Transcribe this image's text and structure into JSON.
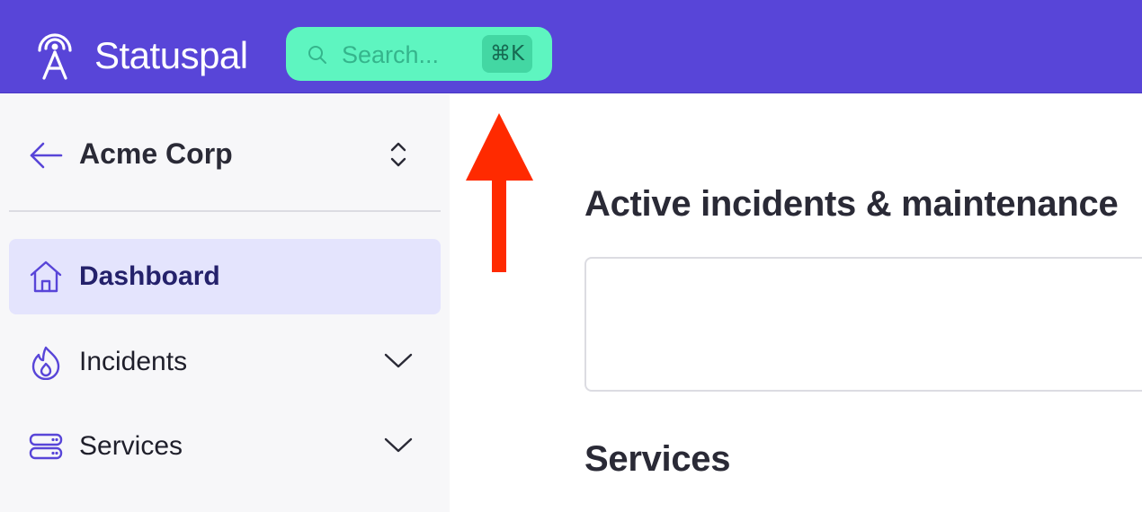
{
  "app": {
    "brand": "Statuspal",
    "logo_icon": "broadcast-tower-icon",
    "accent_color": "#5845d8"
  },
  "search": {
    "placeholder": "Search...",
    "shortcut": "⌘K",
    "icon": "search-icon",
    "background": "#5ef5c0"
  },
  "sidebar": {
    "org": {
      "back_icon": "arrow-left-icon",
      "name": "Acme Corp",
      "switch_icon": "chevron-up-down-icon"
    },
    "items": [
      {
        "label": "Dashboard",
        "icon": "home-icon",
        "active": true,
        "expandable": false
      },
      {
        "label": "Incidents",
        "icon": "fire-icon",
        "active": false,
        "expandable": true
      },
      {
        "label": "Services",
        "icon": "server-icon",
        "active": false,
        "expandable": true
      }
    ]
  },
  "main": {
    "active_heading": "Active incidents & maintenance",
    "services_heading": "Services"
  },
  "annotation": {
    "icon": "red-arrow-up-icon",
    "color": "#ff2a00"
  }
}
